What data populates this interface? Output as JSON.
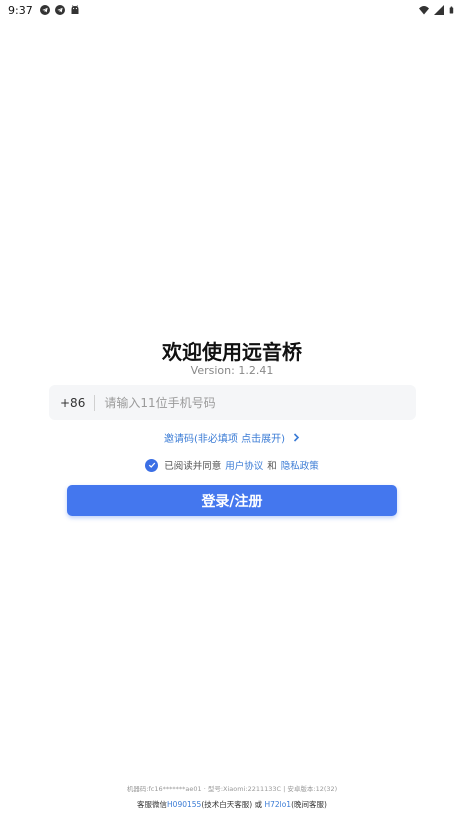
{
  "status_bar": {
    "time": "9:37",
    "left_icons": [
      "telegram-icon",
      "telegram-icon",
      "android-icon"
    ],
    "right_icons": [
      "wifi-icon",
      "signal-icon",
      "battery-icon"
    ]
  },
  "main": {
    "title": "欢迎使用远音桥",
    "version": "Version: 1.2.41",
    "phone": {
      "country_code": "+86",
      "placeholder": "请输入11位手机号码",
      "value": ""
    },
    "invite_code_label": "邀请码(非必填项 点击展开)",
    "agreement": {
      "prefix": "已阅读并同意",
      "user_agreement": "用户协议",
      "and": "和",
      "privacy_policy": "隐私政策",
      "checked": true
    },
    "login_button": "登录/注册"
  },
  "footer": {
    "device_info": "机器码:fc16*******ae01 · 型号:Xiaomi:2211133C | 安卓版本:12(32)",
    "support": {
      "prefix": "客服微信",
      "wechat1": "H090155",
      "wechat1_note": "(技术白天客服)",
      "or": "或",
      "wechat2": "H72lo1",
      "wechat2_note": "(晚间客服)"
    }
  },
  "colors": {
    "accent": "#4477ee",
    "link": "#3a7bd5",
    "input_bg": "#f5f6f8"
  }
}
